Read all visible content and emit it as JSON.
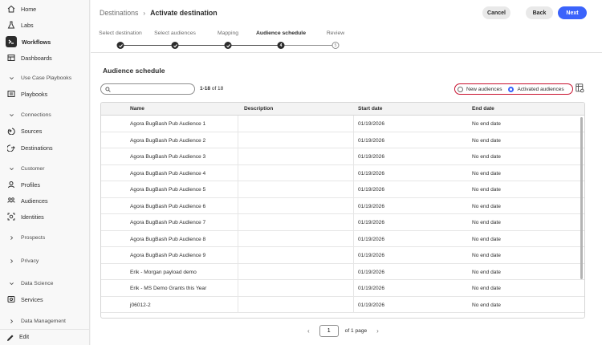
{
  "sidebar": {
    "items": [
      {
        "label": "Home",
        "icon": "home-icon"
      },
      {
        "label": "Labs",
        "icon": "flask-icon"
      },
      {
        "label": "Workflows",
        "icon": "workflow-icon"
      },
      {
        "label": "Dashboards",
        "icon": "dashboard-icon"
      },
      {
        "label": "Use Case Playbooks",
        "icon": "chevron-down-icon"
      },
      {
        "label": "Playbooks",
        "icon": "playbook-icon"
      },
      {
        "label": "Connections",
        "icon": "chevron-down-icon"
      },
      {
        "label": "Sources",
        "icon": "sources-icon"
      },
      {
        "label": "Destinations",
        "icon": "destinations-icon"
      },
      {
        "label": "Customer",
        "icon": "chevron-down-icon"
      },
      {
        "label": "Profiles",
        "icon": "profile-icon"
      },
      {
        "label": "Audiences",
        "icon": "audiences-icon"
      },
      {
        "label": "Identities",
        "icon": "identities-icon"
      },
      {
        "label": "Prospects",
        "icon": "chevron-right-icon"
      },
      {
        "label": "Privacy",
        "icon": "chevron-right-icon"
      },
      {
        "label": "Data Science",
        "icon": "chevron-down-icon"
      },
      {
        "label": "Services",
        "icon": "services-icon"
      },
      {
        "label": "Data Management",
        "icon": "chevron-right-icon"
      }
    ],
    "edit_label": "Edit"
  },
  "header": {
    "breadcrumb_parent": "Destinations",
    "breadcrumb_current": "Activate destination",
    "cancel_label": "Cancel",
    "back_label": "Back",
    "next_label": "Next"
  },
  "steps": [
    {
      "label": "Select destination",
      "status": "done"
    },
    {
      "label": "Select audiences",
      "status": "done"
    },
    {
      "label": "Mapping",
      "status": "done"
    },
    {
      "label": "Audience schedule",
      "status": "active",
      "num": "4"
    },
    {
      "label": "Review",
      "status": "pending",
      "num": "5"
    }
  ],
  "main": {
    "section_title": "Audience schedule",
    "search_placeholder": "",
    "count_range": "1-18",
    "count_total": "of 18",
    "radio_new": "New audiences",
    "radio_activated": "Activated audiences"
  },
  "table": {
    "columns": [
      "Name",
      "Description",
      "Start date",
      "End date"
    ],
    "rows": [
      {
        "name": "Agora BugBash Pub Audience 1",
        "description": "",
        "start": "01/19/2026",
        "end": "No end date"
      },
      {
        "name": "Agora BugBash Pub Audience 2",
        "description": "",
        "start": "01/19/2026",
        "end": "No end date"
      },
      {
        "name": "Agora BugBash Pub Audience 3",
        "description": "",
        "start": "01/19/2026",
        "end": "No end date"
      },
      {
        "name": "Agora BugBash Pub Audience 4",
        "description": "",
        "start": "01/19/2026",
        "end": "No end date"
      },
      {
        "name": "Agora BugBash Pub Audience 5",
        "description": "",
        "start": "01/19/2026",
        "end": "No end date"
      },
      {
        "name": "Agora BugBash Pub Audience 6",
        "description": "",
        "start": "01/19/2026",
        "end": "No end date"
      },
      {
        "name": "Agora BugBash Pub Audience 7",
        "description": "",
        "start": "01/19/2026",
        "end": "No end date"
      },
      {
        "name": "Agora BugBash Pub Audience 8",
        "description": "",
        "start": "01/19/2026",
        "end": "No end date"
      },
      {
        "name": "Agora BugBash Pub Audience 9",
        "description": "",
        "start": "01/19/2026",
        "end": "No end date"
      },
      {
        "name": "Erik - Morgan payload demo",
        "description": "",
        "start": "01/19/2026",
        "end": "No end date"
      },
      {
        "name": "Erik - MS Demo Grants this Year",
        "description": "",
        "start": "01/19/2026",
        "end": "No end date"
      },
      {
        "name": "j06012-2",
        "description": "",
        "start": "01/19/2026",
        "end": "No end date"
      }
    ]
  },
  "pager": {
    "page_value": "1",
    "of_label": "of 1 page",
    "prev": "‹",
    "next": "›"
  }
}
